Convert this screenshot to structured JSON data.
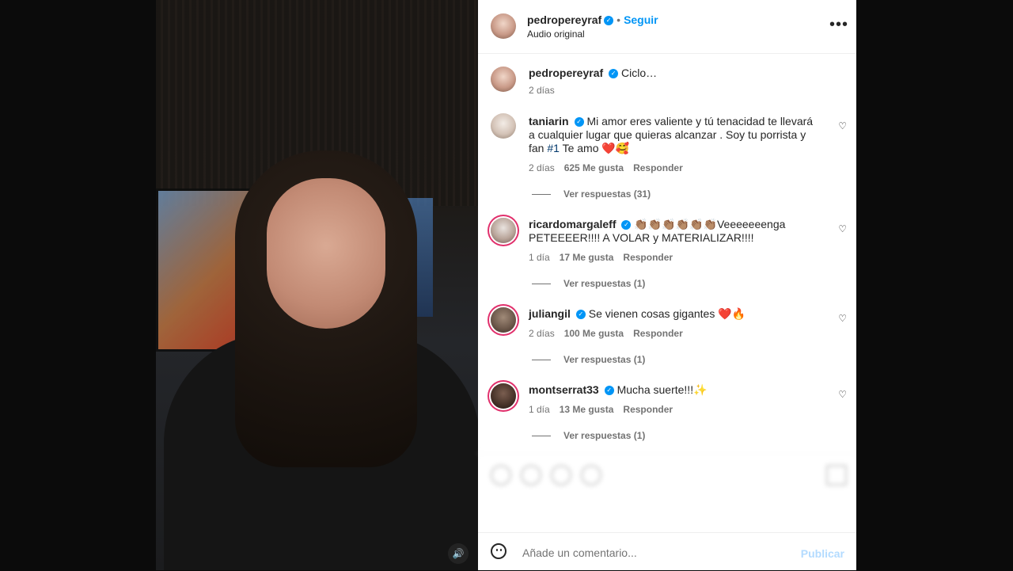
{
  "header": {
    "username": "pedropereyraf",
    "follow_label": "Seguir",
    "subtitle": "Audio original",
    "more_icon": "more-horizontal-icon"
  },
  "caption": {
    "username": "pedropereyraf",
    "text": "Ciclo…",
    "time": "2 días"
  },
  "comments": [
    {
      "username": "taniarin",
      "text_before_tag": "Mi amor eres valiente y tú tenacidad te llevará a cualquier lugar que quieras alcanzar . Soy tu porrista y fan ",
      "hashtag": "#1",
      "text_after_tag": " Te amo ❤️🥰",
      "time": "2 días",
      "likes": "625 Me gusta",
      "reply_label": "Responder",
      "view_replies": "Ver respuestas (31)"
    },
    {
      "username": "ricardomargaleff",
      "text": "👏🏽👏🏽👏🏽👏🏽👏🏽👏🏽Veeeeeeenga PETEEEER!!!! A VOLAR y MATERIALIZAR!!!!",
      "time": "1 día",
      "likes": "17 Me gusta",
      "reply_label": "Responder",
      "view_replies": "Ver respuestas (1)"
    },
    {
      "username": "juliangil",
      "text": "Se vienen cosas gigantes ❤️🔥",
      "time": "2 días",
      "likes": "100 Me gusta",
      "reply_label": "Responder",
      "view_replies": "Ver respuestas (1)"
    },
    {
      "username": "montserrat33",
      "text": "Mucha suerte!!!✨",
      "time": "1 día",
      "likes": "13 Me gusta",
      "reply_label": "Responder",
      "view_replies": "Ver respuestas (1)"
    }
  ],
  "composer": {
    "placeholder": "Añade un comentario...",
    "publish_label": "Publicar"
  },
  "colors": {
    "accent": "#0095f6",
    "publish_disabled": "#b3dbff",
    "muted_text": "#737373"
  }
}
